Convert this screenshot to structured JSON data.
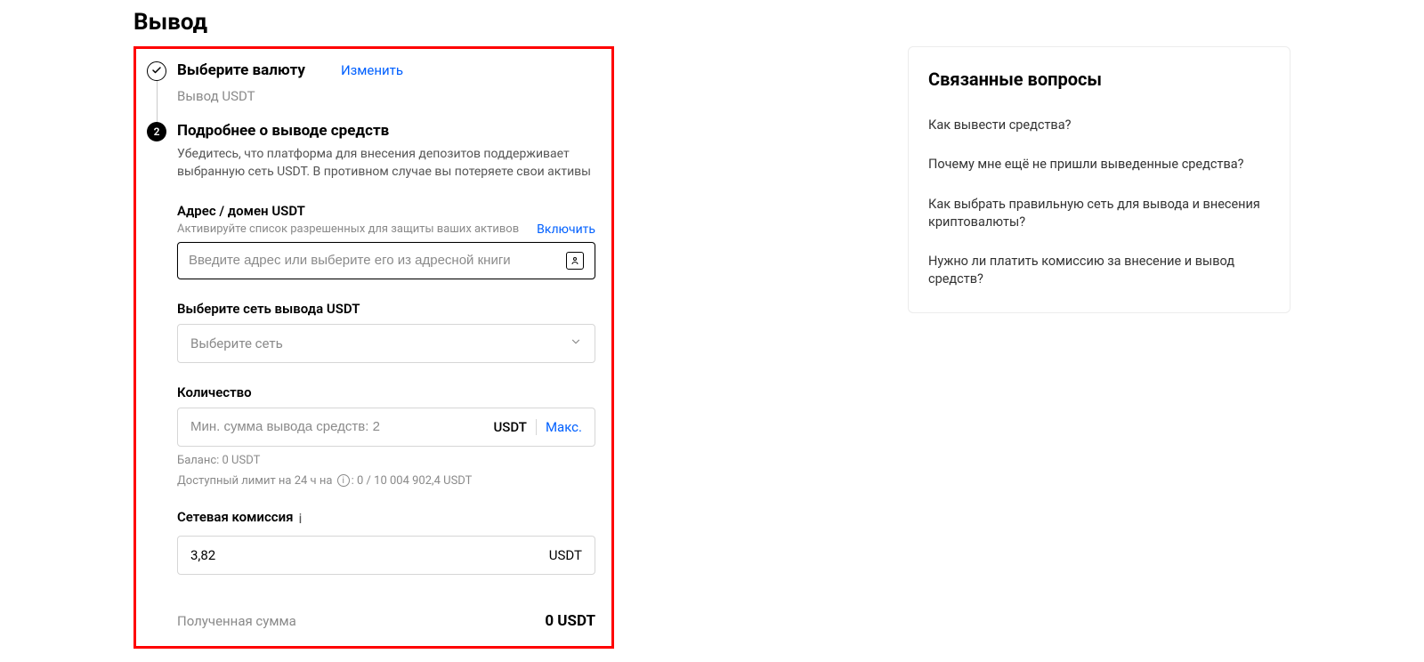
{
  "page_title": "Вывод",
  "step1": {
    "title": "Выберите валюту",
    "change": "Изменить",
    "sub": "Вывод USDT"
  },
  "step2": {
    "number": "2",
    "title": "Подробнее о выводе средств",
    "desc": "Убедитесь, что платформа для внесения депозитов поддерживает выбранную сеть USDT. В противном случае вы потеряете свои активы"
  },
  "address": {
    "label": "Адрес / домен USDT",
    "hint": "Активируйте список разрешенных для защиты ваших активов",
    "enable": "Включить",
    "placeholder": "Введите адрес или выберите его из адресной книги"
  },
  "network": {
    "label": "Выберите сеть вывода USDT",
    "placeholder": "Выберите сеть"
  },
  "amount": {
    "label": "Количество",
    "placeholder": "Мин. сумма вывода средств: 2",
    "unit": "USDT",
    "max": "Макс.",
    "balance": "Баланс: 0 USDT",
    "limit_prefix": "Доступный лимит на 24 ч на",
    "limit_suffix": ": 0 / 10 004 902,4 USDT"
  },
  "fee": {
    "label": "Сетевая комиссия",
    "value": "3,82",
    "unit": "USDT"
  },
  "received": {
    "label": "Полученная сумма",
    "value": "0 USDT"
  },
  "faq": {
    "title": "Связанные вопросы",
    "items": [
      "Как вывести средства?",
      "Почему мне ещё не пришли выведенные средства?",
      "Как выбрать правильную сеть для вывода и внесения криптовалюты?",
      "Нужно ли платить комиссию за внесение и вывод средств?"
    ]
  }
}
